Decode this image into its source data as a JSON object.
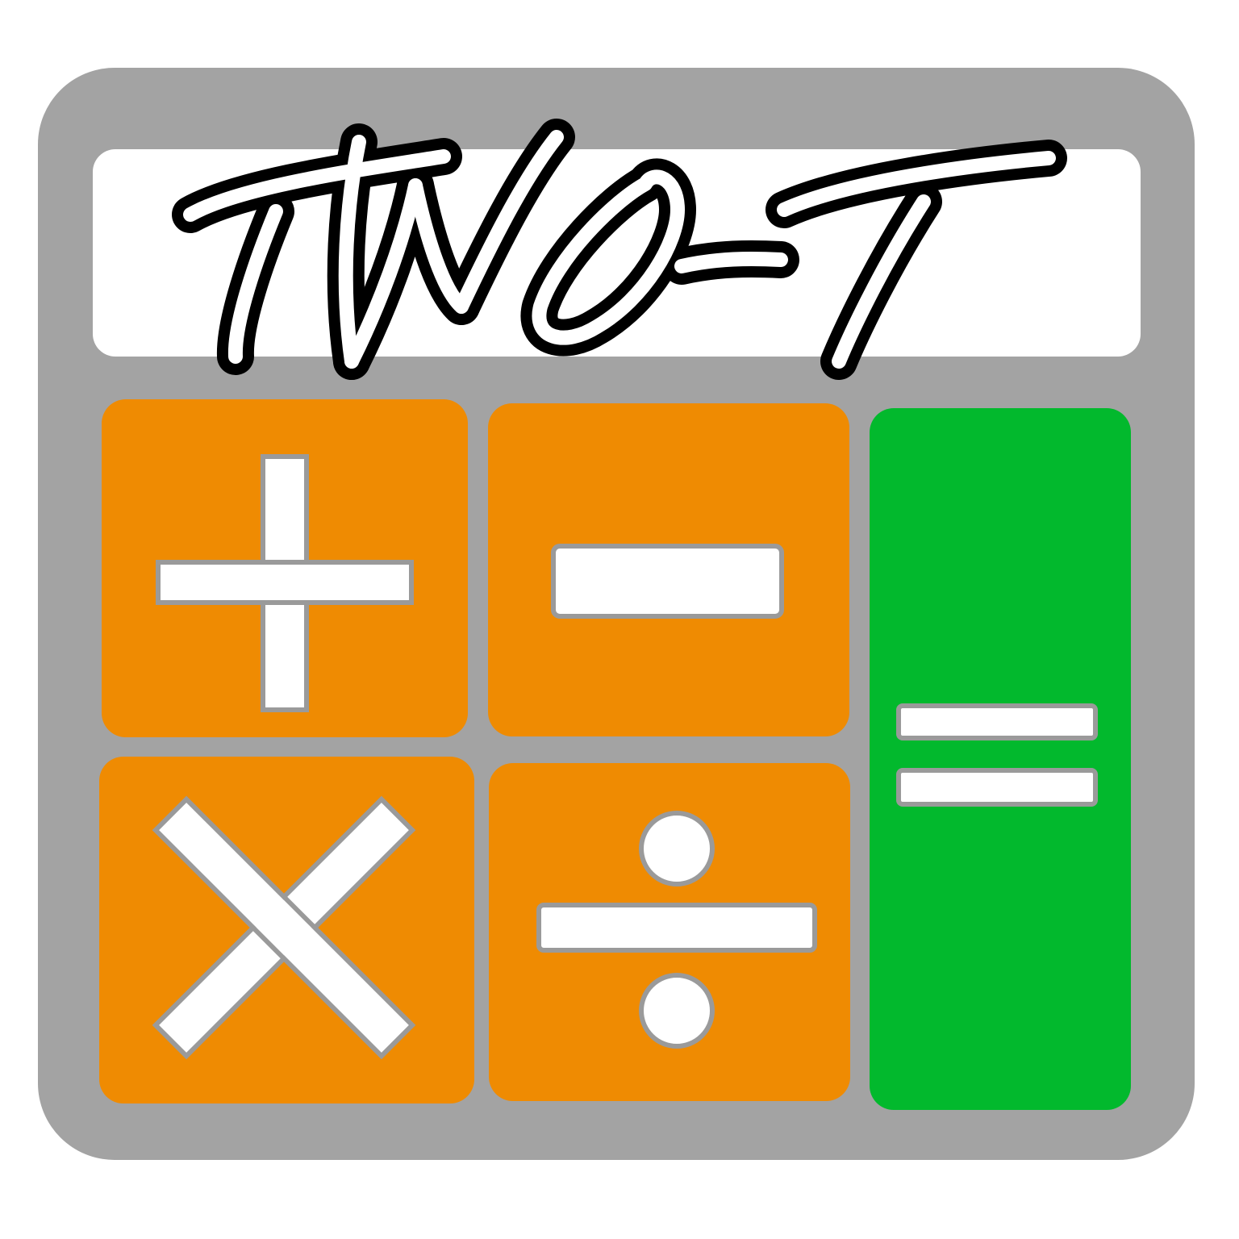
{
  "app": {
    "logo_text": "TWO-T"
  },
  "colors": {
    "body": "#a3a3a3",
    "display": "#ffffff",
    "operator_key": "#ef8b02",
    "equals_key": "#02b92d",
    "glyph_fill": "#ffffff",
    "glyph_outline": "#9a9a9a",
    "logo_outline": "#000000"
  },
  "keys": [
    {
      "name": "plus-key",
      "icon": "plus-icon"
    },
    {
      "name": "minus-key",
      "icon": "minus-icon"
    },
    {
      "name": "multiply-key",
      "icon": "multiply-icon"
    },
    {
      "name": "divide-key",
      "icon": "divide-icon"
    },
    {
      "name": "equals-key",
      "icon": "equals-icon"
    }
  ]
}
